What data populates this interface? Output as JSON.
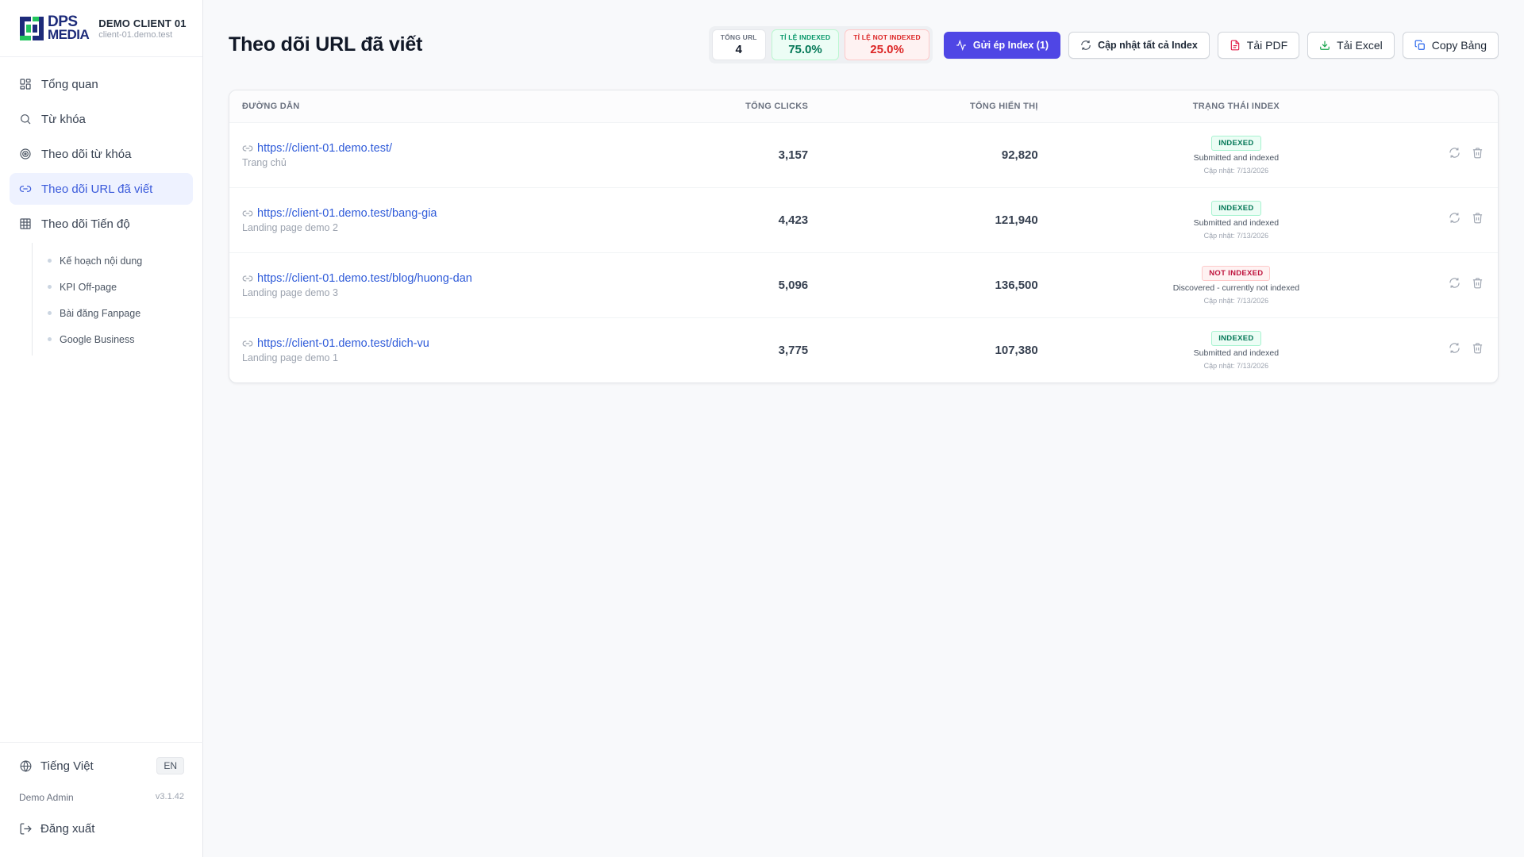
{
  "brand": {
    "logo_line1": "DPS",
    "logo_line2": "MEDIA",
    "client_name": "DEMO CLIENT 01",
    "client_domain": "client-01.demo.test"
  },
  "nav": {
    "items": [
      {
        "label": "Tổng quan",
        "icon": "grid-icon"
      },
      {
        "label": "Từ khóa",
        "icon": "search-icon"
      },
      {
        "label": "Theo dõi từ khóa",
        "icon": "target-icon"
      },
      {
        "label": "Theo dõi URL đã viết",
        "icon": "link-icon",
        "active": true
      },
      {
        "label": "Theo dõi Tiến độ",
        "icon": "table-icon"
      }
    ],
    "subitems": [
      "Kế hoạch nội dung",
      "KPI Off-page",
      "Bài đăng Fanpage",
      "Google Business"
    ]
  },
  "footer": {
    "language": "Tiếng Việt",
    "lang_toggle": "EN",
    "user": "Demo Admin",
    "version": "v3.1.42",
    "logout": "Đăng xuất"
  },
  "page": {
    "title": "Theo dõi URL đã viết"
  },
  "stats": {
    "total_label": "TỔNG URL",
    "total_value": "4",
    "indexed_label": "TỈ LỆ INDEXED",
    "indexed_value": "75.0%",
    "not_indexed_label": "TỈ LỆ NOT INDEXED",
    "not_indexed_value": "25.0%"
  },
  "toolbar": {
    "submit_label": "Gửi ép Index (1)",
    "refresh_all_label": "Cập nhật tất cả Index",
    "pdf_label": "Tải PDF",
    "excel_label": "Tải Excel",
    "copy_label": "Copy Bảng"
  },
  "table": {
    "headers": {
      "url": "ĐƯỜNG DẪN",
      "clicks": "TỔNG CLICKS",
      "impressions": "TỔNG HIỂN THỊ",
      "status": "TRẠNG THÁI INDEX"
    },
    "rows": [
      {
        "url": "https://client-01.demo.test/",
        "title": "Trang chủ",
        "clicks": "3,157",
        "impressions": "92,820",
        "status": "INDEXED",
        "status_type": "ok",
        "status_desc": "Submitted and indexed",
        "updated": "Cập nhật: 7/13/2026"
      },
      {
        "url": "https://client-01.demo.test/bang-gia",
        "title": "Landing page demo 2",
        "clicks": "4,423",
        "impressions": "121,940",
        "status": "INDEXED",
        "status_type": "ok",
        "status_desc": "Submitted and indexed",
        "updated": "Cập nhật: 7/13/2026"
      },
      {
        "url": "https://client-01.demo.test/blog/huong-dan",
        "title": "Landing page demo 3",
        "clicks": "5,096",
        "impressions": "136,500",
        "status": "NOT INDEXED",
        "status_type": "bad",
        "status_desc": "Discovered - currently not indexed",
        "updated": "Cập nhật: 7/13/2026"
      },
      {
        "url": "https://client-01.demo.test/dich-vu",
        "title": "Landing page demo 1",
        "clicks": "3,775",
        "impressions": "107,380",
        "status": "INDEXED",
        "status_type": "ok",
        "status_desc": "Submitted and indexed",
        "updated": "Cập nhật: 7/13/2026"
      }
    ]
  },
  "colors": {
    "accent": "#4f46e5",
    "link": "#2f5bd9",
    "indexed": "#047857",
    "not_indexed": "#be123c"
  }
}
